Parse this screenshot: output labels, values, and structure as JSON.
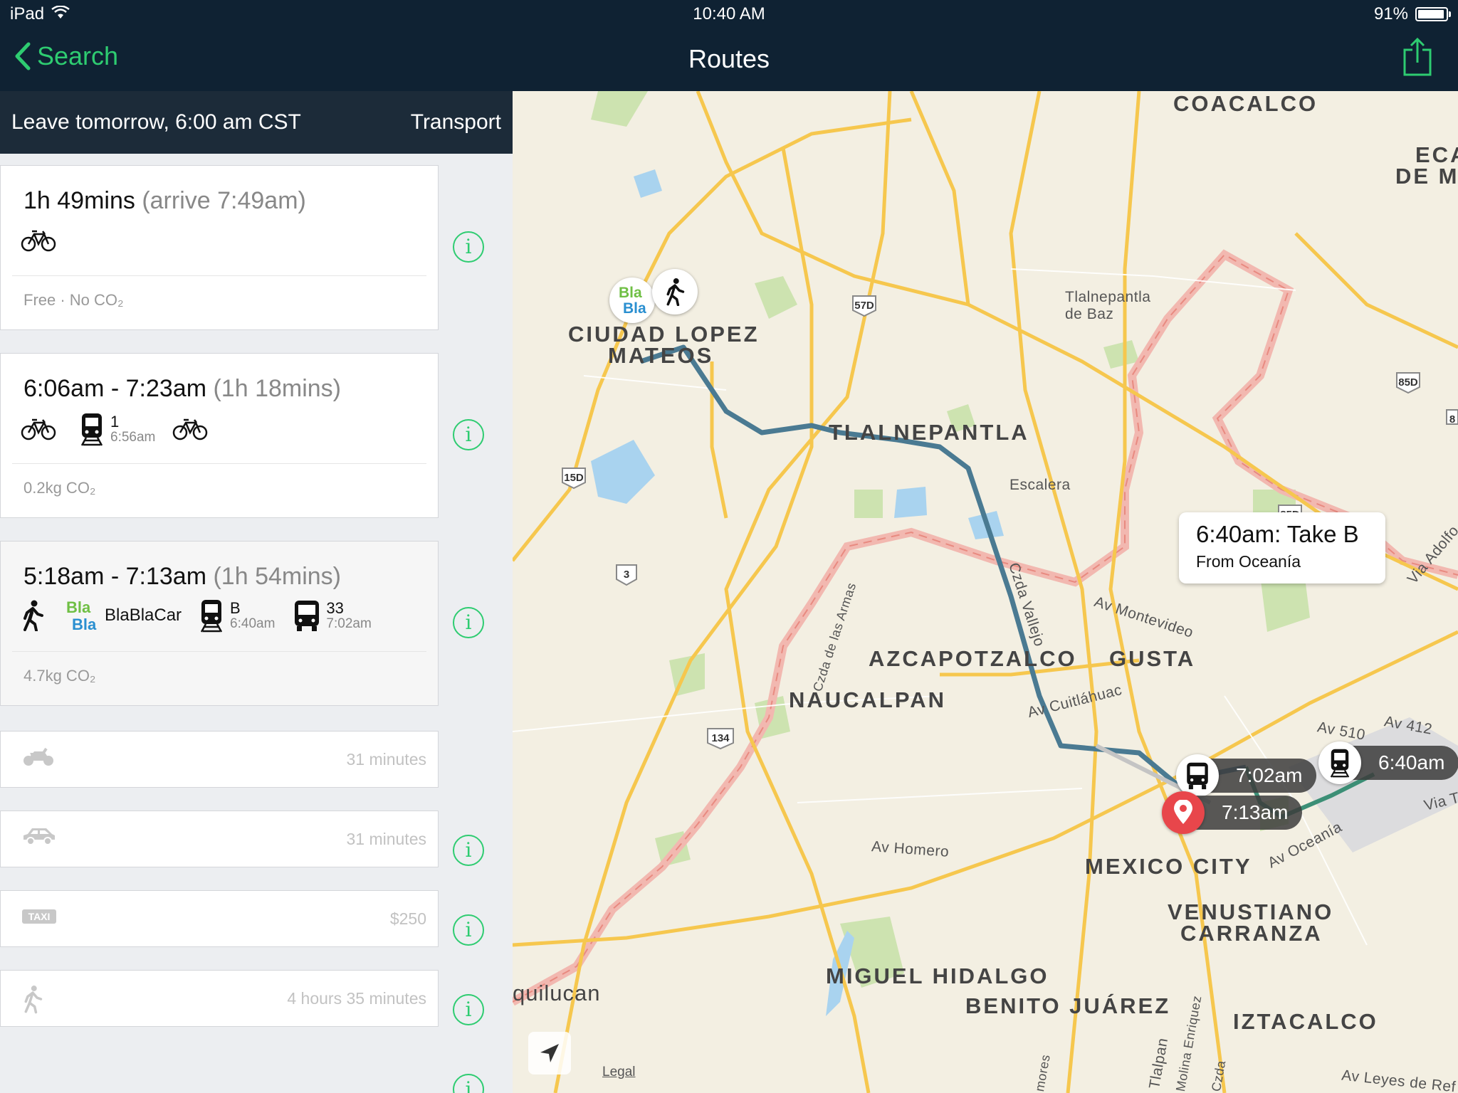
{
  "status_bar": {
    "device": "iPad",
    "time": "10:40 AM",
    "battery": "91%"
  },
  "nav": {
    "back_label": "Search",
    "title": "Routes"
  },
  "filter_bar": {
    "departure": "Leave tomorrow, 6:00 am CST",
    "mode_filter": "Transport"
  },
  "routes": [
    {
      "duration": "1h 49mins",
      "arrival": "(arrive 7:49am)",
      "footer": "Free · No CO₂",
      "modes": [
        "bicycle-icon"
      ]
    },
    {
      "times": "6:06am - 7:23am",
      "duration": "(1h 18mins)",
      "footer": "0.2kg CO₂",
      "legs": [
        {
          "icon": "bicycle-icon"
        },
        {
          "icon": "train-icon",
          "line": "1",
          "time": "6:56am"
        },
        {
          "icon": "bicycle-icon"
        }
      ]
    },
    {
      "times": "5:18am - 7:13am",
      "duration": "(1h 54mins)",
      "footer": "4.7kg CO₂",
      "legs": [
        {
          "icon": "walk-icon"
        },
        {
          "icon": "blablacar-logo",
          "logo_text": "Bla Bla",
          "label": "BlaBlaCar"
        },
        {
          "icon": "train-icon",
          "line": "B",
          "time": "6:40am"
        },
        {
          "icon": "bus-icon",
          "line": "33",
          "time": "7:02am"
        }
      ]
    }
  ],
  "alternatives": [
    {
      "icon": "motorbike-icon",
      "value": "31 minutes"
    },
    {
      "icon": "car-icon",
      "value": "31 minutes"
    },
    {
      "icon": "taxi-icon",
      "icon_text": "TAXI",
      "value": "$250"
    },
    {
      "icon": "walk-icon",
      "value": "4 hours 35 minutes"
    }
  ],
  "map": {
    "labels": {
      "coacalco": "COACALCO",
      "ecatepec_1": "ECA",
      "ecatepec_2": "DE M",
      "ciudad_lopez": "CIUDAD LOPEZ",
      "mateos": "MATEOS",
      "tlalnepantla": "TLALNEPANTLA",
      "tlalnepantla_baz_1": "Tlalnepantla",
      "tlalnepantla_baz_2": "de Baz",
      "escalera": "Escalera",
      "azcapotzalco": "AZCAPOTZALCO",
      "gusta": "GUSTA",
      "naucalpan": "NAUCALPAN",
      "mexico_city": "MEXICO CITY",
      "venustiano": "VENUSTIANO",
      "carranza": "CARRANZA",
      "miguel_hidalgo": "MIGUEL HIDALGO",
      "benito_juarez": "BENITO JUÁREZ",
      "iztacalco": "IZTACALCO",
      "naucalpan_partial": "quilucan",
      "av_montevideo": "Av Montevideo",
      "av_cuitlahuac": "Av Cuitláhuac",
      "czda_vallejo": "Czda Vallejo",
      "czda_armas": "Czda de las Armas",
      "av_homero": "Av Homero",
      "av_oceania": "Av Oceanía",
      "av_510": "Av 510",
      "av_412": "Av 412",
      "via_adolfo": "Via Adolfo",
      "via_ta": "Via Ta",
      "av_leyes": "Av Leyes de Ref",
      "tlalpan": "Tlalpan",
      "molina": "Molina Enriquez",
      "czda_small": "Czda",
      "mores": "mores"
    },
    "shields": [
      "57D",
      "15D",
      "3",
      "134",
      "85D",
      "85D",
      "8"
    ],
    "callout": {
      "title": "6:40am: Take B",
      "subtitle": "From Oceanía"
    },
    "pills": {
      "bus_time": "7:02am",
      "train_time": "6:40am",
      "dest_time": "7:13am"
    },
    "start_logo": "Bla Bla",
    "legal": "Legal"
  },
  "colors": {
    "accent": "#2ecc71",
    "navbar": "#0f2233",
    "route": "#4a7a92"
  }
}
